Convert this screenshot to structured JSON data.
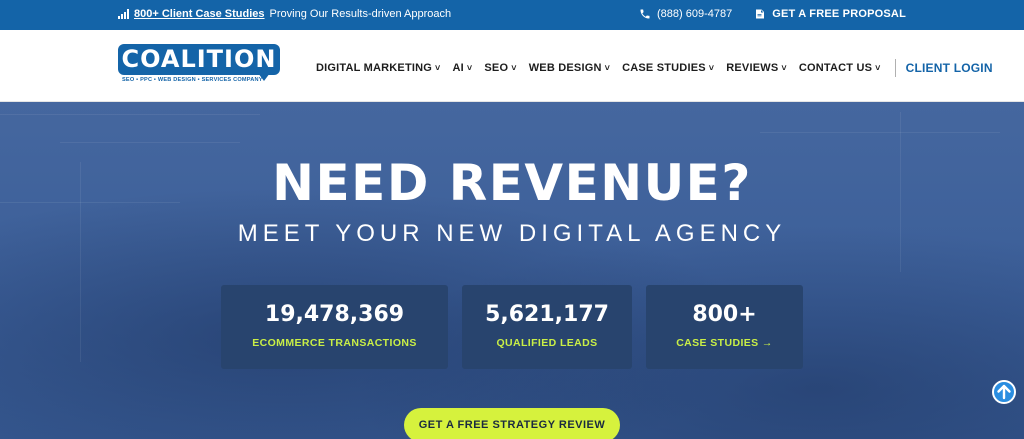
{
  "topbar": {
    "case_link": "800+ Client Case Studies",
    "tagline": "Proving Our Results-driven Approach",
    "phone": "(888) 609-4787",
    "proposal": "GET A FREE PROPOSAL",
    "icons": [
      "signal-bars-icon",
      "phone-icon",
      "proposal-icon"
    ]
  },
  "logo": {
    "name": "COALITION",
    "tagline": "SEO • PPC • WEB DESIGN • SERVICES COMPANY"
  },
  "nav": {
    "items": [
      {
        "label": "DIGITAL MARKETING",
        "caret": "˅"
      },
      {
        "label": "AI",
        "caret": "˅"
      },
      {
        "label": "SEO",
        "caret": "˅"
      },
      {
        "label": "WEB DESIGN",
        "caret": "˅"
      },
      {
        "label": "CASE STUDIES",
        "caret": "˅"
      },
      {
        "label": "REVIEWS",
        "caret": "˅"
      },
      {
        "label": "CONTACT US",
        "caret": "˅"
      }
    ],
    "client_login": "CLIENT LOGIN"
  },
  "hero": {
    "title": "NEED REVENUE?",
    "subtitle": "MEET YOUR NEW DIGITAL AGENCY",
    "stats": [
      {
        "value": "19,478,369",
        "label": "ECOMMERCE TRANSACTIONS"
      },
      {
        "value": "5,621,177",
        "label": "QUALIFIED LEADS"
      },
      {
        "value": "800+",
        "label": "CASE STUDIES →"
      }
    ],
    "cta": "GET A FREE STRATEGY REVIEW"
  },
  "colors": {
    "brand_blue": "#1464a8",
    "hero_blue": "#3a5f9a",
    "stat_box": "#28446e",
    "accent_lime": "#d6f23d",
    "label_lime": "#c9ef46"
  }
}
